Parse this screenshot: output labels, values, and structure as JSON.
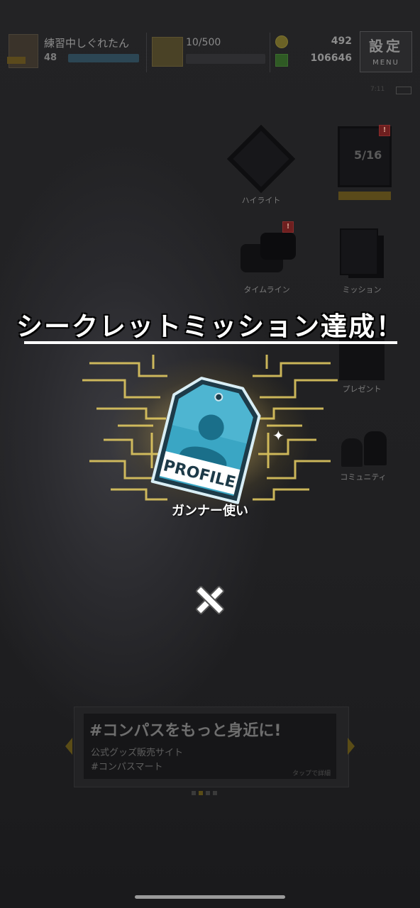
{
  "player": {
    "name": "練習中しぐれたん",
    "level": "48"
  },
  "stamina": {
    "text": "10/500"
  },
  "currency": {
    "coins": "492",
    "points": "106646"
  },
  "menu_button": {
    "title": "設定",
    "sub": "MENU"
  },
  "status": {
    "battery_label": "7:11"
  },
  "side_menu": {
    "highlight": "ハイライト",
    "card_count": "5/16",
    "timeline": "タイムライン",
    "mission": "ミッション",
    "present": "プレゼント",
    "community": "コミュニティ",
    "alert_mark": "!"
  },
  "modal": {
    "title": "シークレットミッション達成！",
    "reward_tag_text": "PROFILE",
    "reward_name": "ガンナー使い"
  },
  "banner": {
    "headline": "#コンパスをもっと身近に!",
    "sub1": "公式グッズ販売サイト",
    "sub2": "#コンパスマート",
    "credit": "タップで詳細"
  },
  "colors": {
    "accent_gold": "#e8cf63",
    "tag_blue": "#3aa6c4",
    "tag_border": "#1d3a48",
    "overlay": "#1d1d1f"
  }
}
